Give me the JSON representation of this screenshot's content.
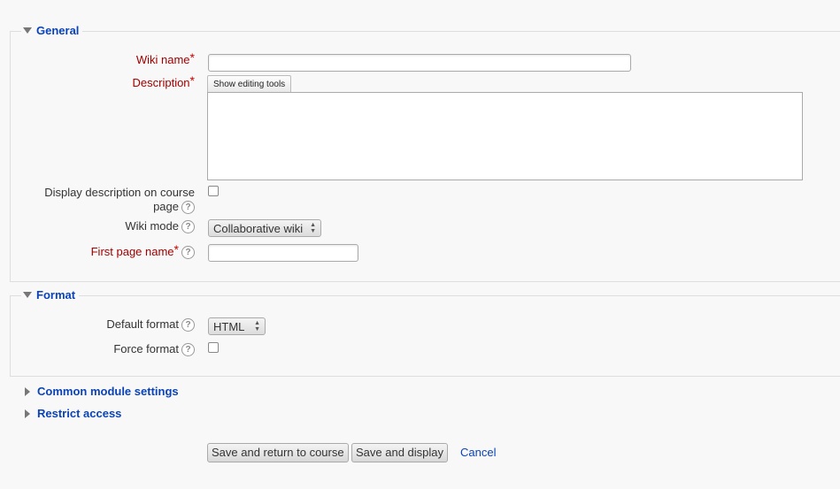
{
  "general": {
    "legend": "General",
    "wiki_name_label": "Wiki name",
    "wiki_name_value": "",
    "description_label": "Description",
    "show_editing_tools": "Show editing tools",
    "description_value": "",
    "display_description_label_line1": "Display description on course",
    "display_description_label_line2": "page",
    "wiki_mode_label": "Wiki mode",
    "wiki_mode_value": "Collaborative wiki",
    "first_page_label": "First page name",
    "first_page_value": "",
    "required_marker": "*",
    "help_icon": "?"
  },
  "format": {
    "legend": "Format",
    "default_format_label": "Default format",
    "default_format_value": "HTML",
    "force_format_label": "Force format"
  },
  "sections": {
    "common_module": "Common module settings",
    "restrict_access": "Restrict access"
  },
  "actions": {
    "save_return": "Save and return to course",
    "save_display": "Save and display",
    "cancel": "Cancel"
  },
  "colors": {
    "legend": "#0a43b8",
    "required": "#a00000"
  },
  "icons": {
    "expanded": "triangle-down-icon",
    "collapsed": "triangle-right-icon",
    "help": "help-icon"
  }
}
